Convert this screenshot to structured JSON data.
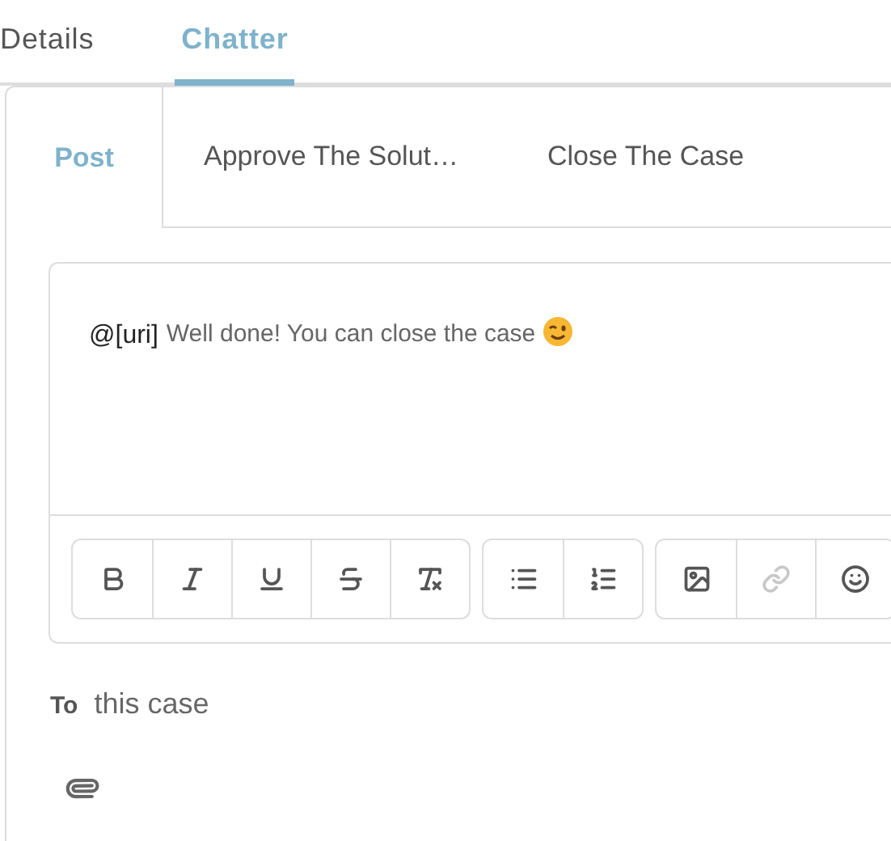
{
  "tabs": [
    {
      "label": "Details",
      "selected": false
    },
    {
      "label": "Chatter",
      "selected": true
    }
  ],
  "publisher_tabs": [
    {
      "label": "Post",
      "selected": true
    },
    {
      "label": "Approve The Solut…",
      "selected": false
    },
    {
      "label": "Close The Case",
      "selected": false
    }
  ],
  "editor": {
    "mention": "@[uri]",
    "text": "Well done! You can close the case"
  },
  "toolbar": [
    {
      "buttons": [
        {
          "kind": "bold",
          "disabled": false
        },
        {
          "kind": "italic",
          "disabled": false
        },
        {
          "kind": "underline",
          "disabled": false
        },
        {
          "kind": "strike",
          "disabled": false
        },
        {
          "kind": "clear",
          "disabled": false
        }
      ]
    },
    {
      "buttons": [
        {
          "kind": "bullets",
          "disabled": false
        },
        {
          "kind": "numbers",
          "disabled": false
        }
      ]
    },
    {
      "buttons": [
        {
          "kind": "image",
          "disabled": false
        },
        {
          "kind": "link",
          "disabled": true
        },
        {
          "kind": "emoji",
          "disabled": false
        }
      ]
    }
  ],
  "recipient": {
    "label": "To",
    "value": "this case"
  }
}
